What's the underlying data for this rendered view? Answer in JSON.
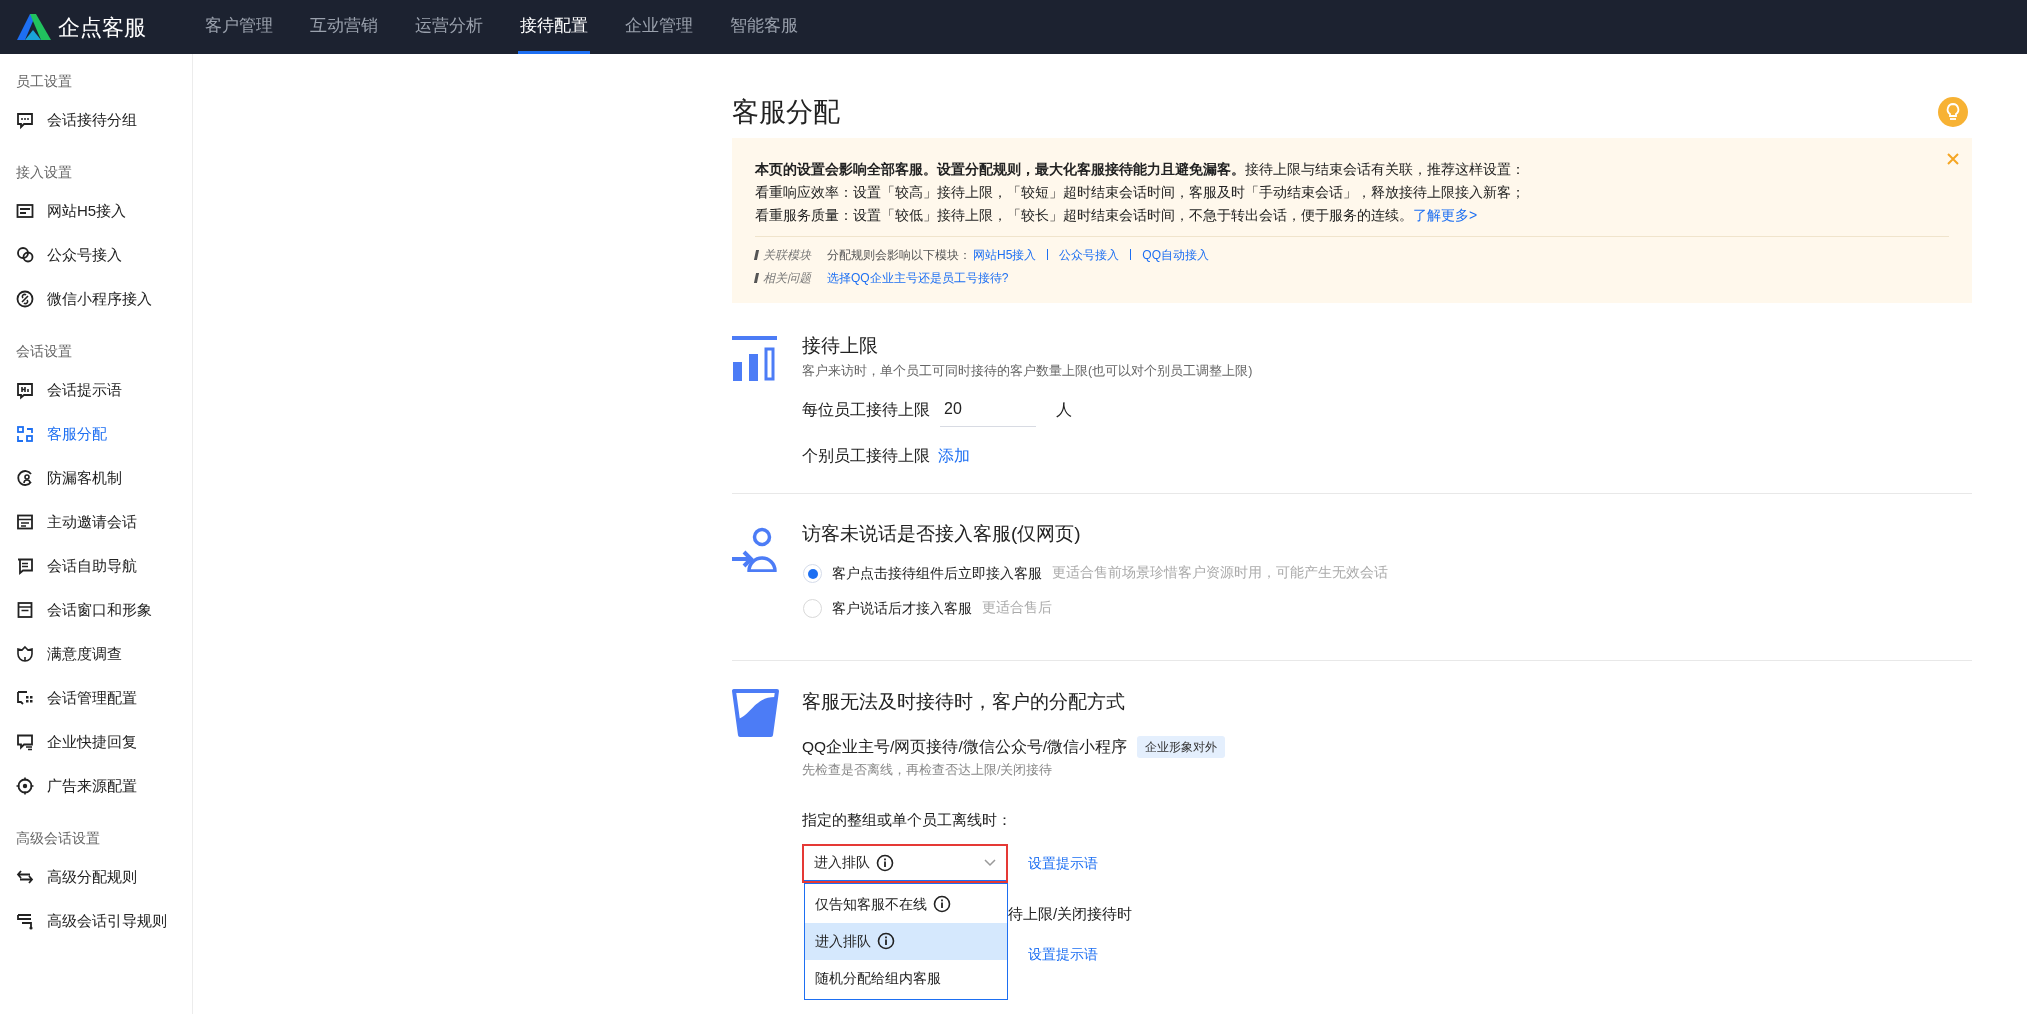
{
  "brand": {
    "name": "企点客服"
  },
  "nav": [
    {
      "label": "客户管理",
      "selected": false
    },
    {
      "label": "互动营销",
      "selected": false
    },
    {
      "label": "运营分析",
      "selected": false
    },
    {
      "label": "接待配置",
      "selected": true
    },
    {
      "label": "企业管理",
      "selected": false
    },
    {
      "label": "智能客服",
      "selected": false
    }
  ],
  "sidebar": [
    {
      "heading": "员工设置",
      "items": [
        {
          "label": "会话接待分组",
          "selected": false
        }
      ]
    },
    {
      "heading": "接入设置",
      "items": [
        {
          "label": "网站H5接入",
          "selected": false
        },
        {
          "label": "公众号接入",
          "selected": false
        },
        {
          "label": "微信小程序接入",
          "selected": false
        }
      ]
    },
    {
      "heading": "会话设置",
      "items": [
        {
          "label": "会话提示语",
          "selected": false
        },
        {
          "label": "客服分配",
          "selected": true
        },
        {
          "label": "防漏客机制",
          "selected": false
        },
        {
          "label": "主动邀请会话",
          "selected": false
        },
        {
          "label": "会话自助导航",
          "selected": false
        },
        {
          "label": "会话窗口和形象",
          "selected": false
        },
        {
          "label": "满意度调查",
          "selected": false
        },
        {
          "label": "会话管理配置",
          "selected": false
        },
        {
          "label": "企业快捷回复",
          "selected": false
        },
        {
          "label": "广告来源配置",
          "selected": false
        }
      ]
    },
    {
      "heading": "高级会话设置",
      "items": [
        {
          "label": "高级分配规则",
          "selected": false
        },
        {
          "label": "高级会话引导规则",
          "selected": false
        }
      ]
    }
  ],
  "page": {
    "title": "客服分配"
  },
  "notice": {
    "lead": "**本页的设置会影响全部客服。设置分配规则，最大化客服接待能力且避免漏客。**接待上限与结束会话有关联，推荐这样设置：",
    "lines": [
      "看重响应效率：设置「较高」接待上限，「较短」超时结束会话时间，客服及时「手动结束会话」，释放接待上限接入新客；",
      "看重服务质量：设置「较低」接待上限，「较长」超时结束会话时间，不急于转出会话，便于服务的连续。"
    ],
    "more_link": "了解更多>",
    "related": [
      {
        "label": "关联模块",
        "text": "分配规则会影响以下模块：",
        "links": [
          "网站H5接入",
          "公众号接入",
          "QQ自动接入"
        ]
      },
      {
        "label": "相关问题",
        "links": [
          "选择QQ企业主号还是员工号接待?"
        ]
      }
    ]
  },
  "limit_section": {
    "title": "接待上限",
    "description": "客户来访时，单个员工可同时接待的客户数量上限(也可以对个别员工调整上限)",
    "limit_label": "每位员工接待上限",
    "limit_value": "20",
    "limit_unit": "人",
    "individual_label": "个别员工接待上限",
    "individual_link": "添加"
  },
  "silent_section": {
    "title": "访客未说话是否接入客服(仅网页)",
    "options": [
      {
        "label": "客户点击接待组件后立即接入客服",
        "hint": "更适合售前场景珍惜客户资源时用，可能产生无效会话",
        "selected": true
      },
      {
        "label": "客户说话后才接入客服",
        "hint": "更适合售后",
        "selected": false
      }
    ]
  },
  "assign_section": {
    "title": "客服无法及时接待时，客户的分配方式",
    "channels": "QQ企业主号/网页接待/微信公众号/微信小程序",
    "tag": "企业形象对外",
    "hint": "先检查是否离线，再检查否达上限/关闭接待",
    "offline_label": "指定的整组或单个员工离线时：",
    "select_value": "进入排队",
    "select_info": true,
    "prompt_link": "设置提示语",
    "menu": [
      {
        "label": "仅告知客服不在线",
        "info": true,
        "selected": false
      },
      {
        "label": "进入排队",
        "info": true,
        "selected": true
      },
      {
        "label": "随机分配给组内客服",
        "info": false,
        "selected": false
      }
    ],
    "limit_label": "待上限/关闭接待时",
    "limit_prompt_link": "设置提示语"
  }
}
